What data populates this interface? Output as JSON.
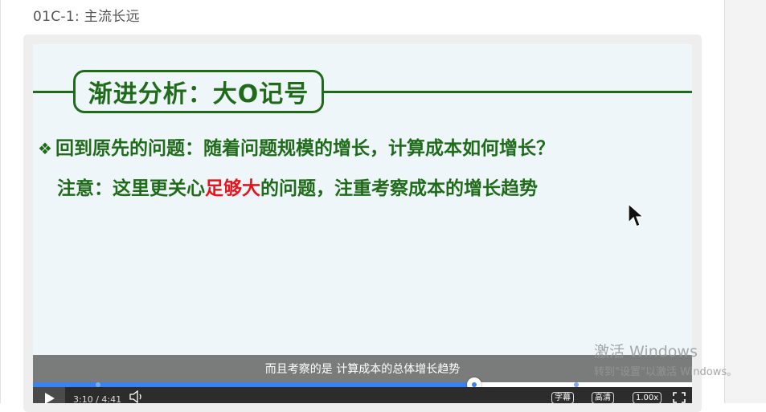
{
  "page": {
    "lesson_title": "01C-1: 主流长远"
  },
  "slide": {
    "heading": "渐进分析：大O记号",
    "bullet": "回到原先的问题：随着问题规模的增长，计算成本如何增长？",
    "note_prefix": "注意：这里更关心",
    "note_highlight": "足够大",
    "note_suffix": "的问题，注重考察成本的增长趋势",
    "bullet_icon": "diamond-bullet-icon",
    "colors": {
      "green": "#1f6b1a",
      "highlight": "#e8141b",
      "background": "#eef6fa"
    }
  },
  "player": {
    "subtitle": "而且考察的是 计算成本的总体增长趋势",
    "time": "3:10 / 4:41",
    "progress": 0.67,
    "buttons": {
      "captions": "字幕",
      "quality": "高清",
      "speed": "1.00x"
    },
    "icons": [
      "play-icon",
      "volume-icon",
      "fullscreen-icon"
    ],
    "accent_color": "#3b82f0"
  },
  "os_watermark": {
    "line1": "激活 Windows",
    "line2": "转到\"设置\"以激活 Windows。"
  }
}
